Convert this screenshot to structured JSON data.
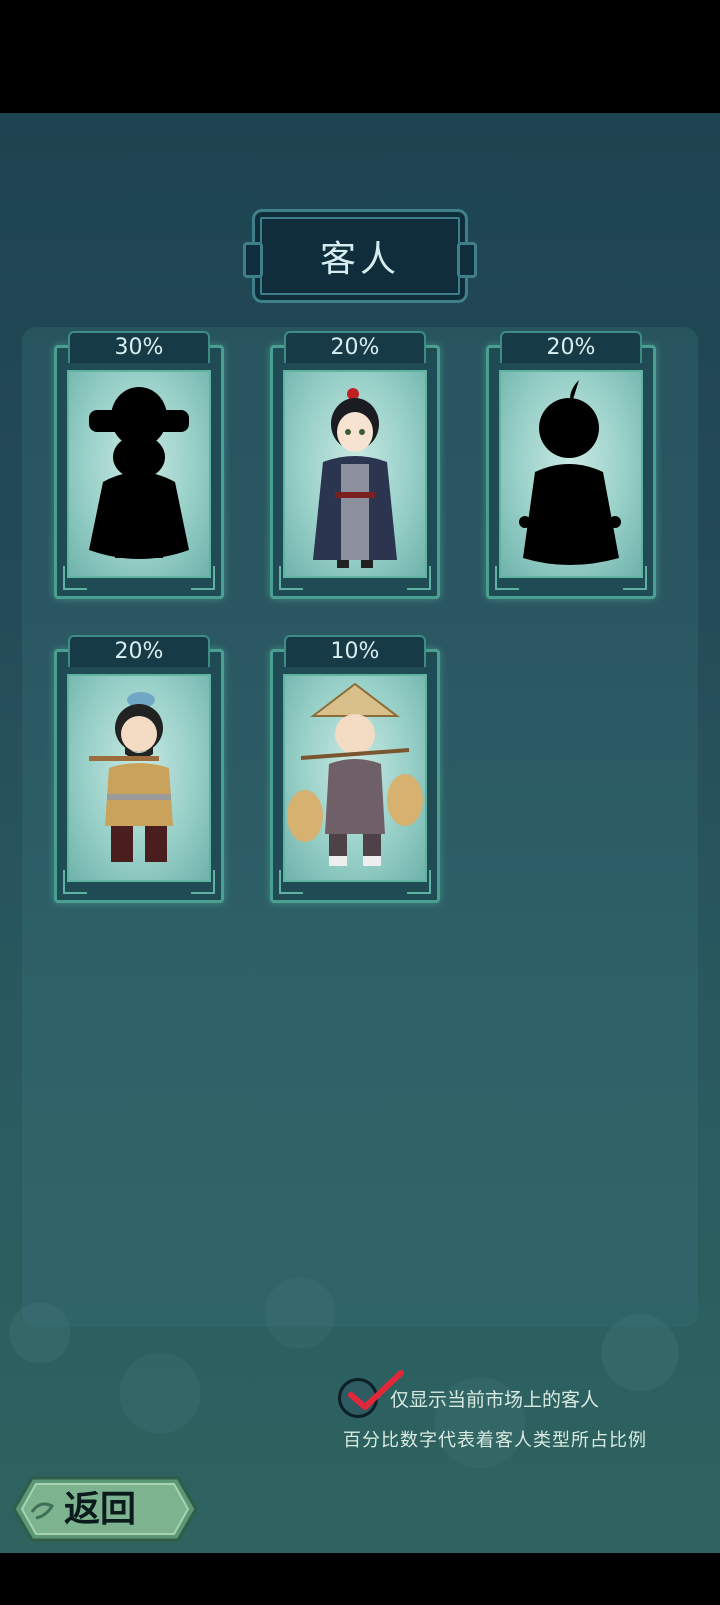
{
  "title": "客人",
  "cards": [
    {
      "percent": "30%",
      "revealed": false
    },
    {
      "percent": "20%",
      "revealed": true
    },
    {
      "percent": "20%",
      "revealed": false
    },
    {
      "percent": "20%",
      "revealed": true
    },
    {
      "percent": "10%",
      "revealed": true
    }
  ],
  "filter": {
    "label": "仅显示当前市场上的客人",
    "checked": true
  },
  "note": "百分比数字代表着客人类型所占比例",
  "back_label": "返回",
  "colors": {
    "accent": "#4aa090",
    "check": "#e0283a",
    "background": "#244c58"
  }
}
